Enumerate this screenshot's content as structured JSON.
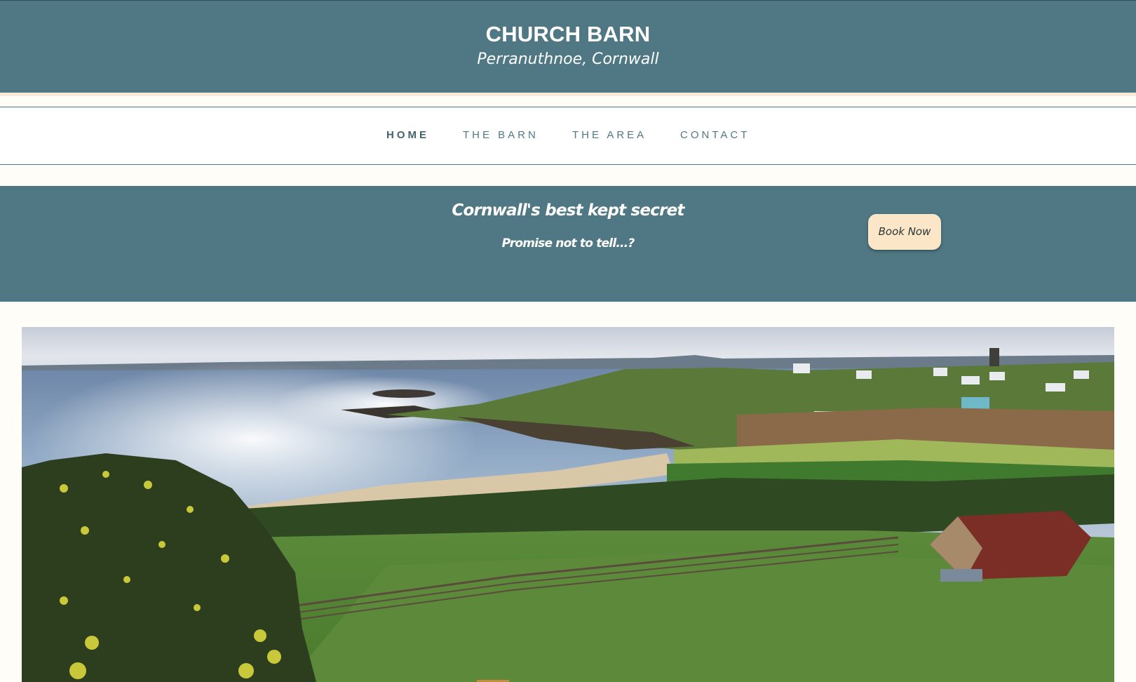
{
  "header": {
    "title": "CHURCH BARN",
    "subtitle": "Perranuthnoe, Cornwall"
  },
  "nav": {
    "items": [
      {
        "label": "HOME",
        "active": true
      },
      {
        "label": "THE BARN",
        "active": false
      },
      {
        "label": "THE AREA",
        "active": false
      },
      {
        "label": "CONTACT",
        "active": false
      }
    ]
  },
  "banner": {
    "tagline": "Cornwall's best kept secret",
    "sub_tagline": "Promise not to tell...?",
    "book_button": "Book Now"
  },
  "hero": {
    "image": "coastal-landscape-photo"
  },
  "colors": {
    "primary": "#4f7884",
    "accent": "#fbe7c8",
    "background": "#fffdf8"
  }
}
